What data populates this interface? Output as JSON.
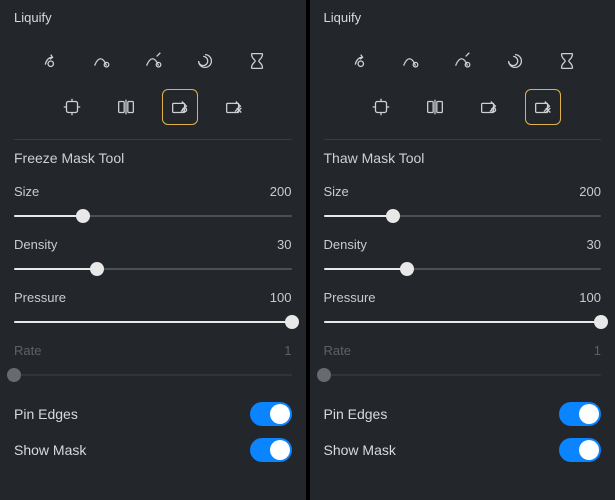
{
  "left": {
    "title": "Liquify",
    "section_title": "Freeze Mask Tool",
    "selected_tool_index": 7,
    "sliders": {
      "size": {
        "label": "Size",
        "value": 200,
        "pct": 25,
        "disabled": false
      },
      "density": {
        "label": "Density",
        "value": 30,
        "pct": 30,
        "disabled": false
      },
      "pressure": {
        "label": "Pressure",
        "value": 100,
        "pct": 100,
        "disabled": false
      },
      "rate": {
        "label": "Rate",
        "value": 1,
        "pct": 0,
        "disabled": true
      }
    },
    "toggles": {
      "pin_edges": {
        "label": "Pin Edges",
        "on": true
      },
      "show_mask": {
        "label": "Show Mask",
        "on": true
      }
    }
  },
  "right": {
    "title": "Liquify",
    "section_title": "Thaw Mask Tool",
    "selected_tool_index": 8,
    "sliders": {
      "size": {
        "label": "Size",
        "value": 200,
        "pct": 25,
        "disabled": false
      },
      "density": {
        "label": "Density",
        "value": 30,
        "pct": 30,
        "disabled": false
      },
      "pressure": {
        "label": "Pressure",
        "value": 100,
        "pct": 100,
        "disabled": false
      },
      "rate": {
        "label": "Rate",
        "value": 1,
        "pct": 0,
        "disabled": true
      }
    },
    "toggles": {
      "pin_edges": {
        "label": "Pin Edges",
        "on": true
      },
      "show_mask": {
        "label": "Show Mask",
        "on": true
      }
    }
  },
  "tool_names": [
    "forward-warp",
    "reconstruct",
    "smooth",
    "twirl",
    "bloat",
    "pucker",
    "mirror",
    "freeze-mask",
    "thaw-mask"
  ]
}
